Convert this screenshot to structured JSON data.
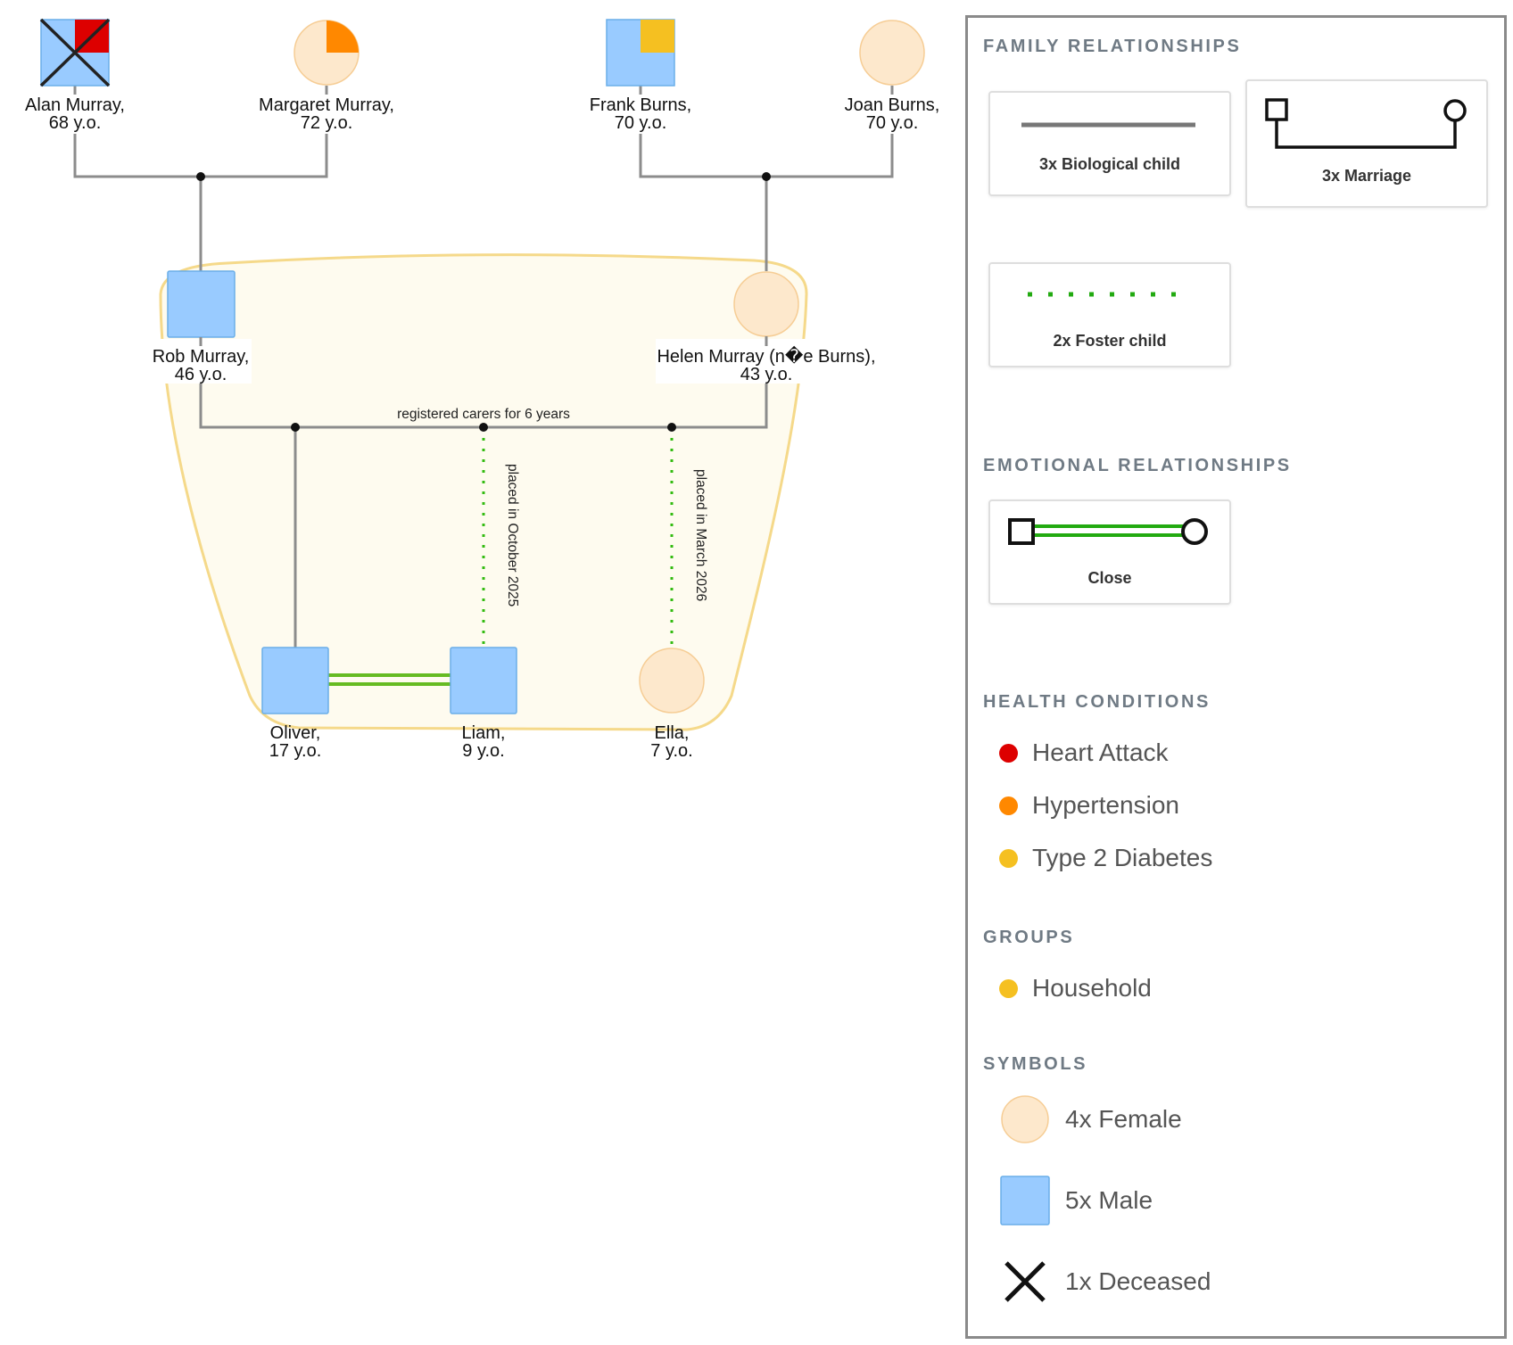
{
  "colors": {
    "male": "#99cbff",
    "male_stroke": "#6aaee8",
    "female": "#fde8cc",
    "female_stroke": "#f6cd95",
    "line_family": "#8c8c8c",
    "line_foster": "#33bb11",
    "line_close": "#66bb22",
    "household": "#f5c021",
    "household_fill": "#fefbef",
    "heart_attack": "#dd0000",
    "hypertension": "#ff8800",
    "type2_diabetes": "#f5c021",
    "deceased_mark": "#222222"
  },
  "people": [
    {
      "id": "alan",
      "name": "Alan Murray,",
      "age": "68 y.o.",
      "sex": "male",
      "deceased": true,
      "condition": "heart_attack"
    },
    {
      "id": "margaret",
      "name": "Margaret Murray,",
      "age": "72 y.o.",
      "sex": "female",
      "condition": "hypertension"
    },
    {
      "id": "frank",
      "name": "Frank Burns,",
      "age": "70 y.o.",
      "sex": "male",
      "condition": "type2_diabetes"
    },
    {
      "id": "joan",
      "name": "Joan Burns,",
      "age": "70 y.o.",
      "sex": "female"
    },
    {
      "id": "rob",
      "name": "Rob Murray,",
      "age": "46 y.o.",
      "sex": "male"
    },
    {
      "id": "helen",
      "name": "Helen Murray (n�e Burns),",
      "age": "43 y.o.",
      "sex": "female"
    },
    {
      "id": "oliver",
      "name": "Oliver,",
      "age": "17 y.o.",
      "sex": "male"
    },
    {
      "id": "liam",
      "name": "Liam,",
      "age": "9 y.o.",
      "sex": "male"
    },
    {
      "id": "ella",
      "name": "Ella,",
      "age": "7 y.o.",
      "sex": "female"
    }
  ],
  "relationship_labels": {
    "carers": "registered carers for 6 years",
    "liam_placement": "placed in October 2025",
    "ella_placement": "placed in March 2026"
  },
  "legend": {
    "family_heading": "FAMILY RELATIONSHIPS",
    "biological_child": "3x Biological child",
    "marriage": "3x Marriage",
    "foster_child": "2x Foster child",
    "emotional_heading": "EMOTIONAL RELATIONSHIPS",
    "close": "Close",
    "health_heading": "HEALTH CONDITIONS",
    "conditions": [
      {
        "label": "Heart Attack",
        "color_key": "heart_attack"
      },
      {
        "label": "Hypertension",
        "color_key": "hypertension"
      },
      {
        "label": "Type 2 Diabetes",
        "color_key": "type2_diabetes"
      }
    ],
    "groups_heading": "GROUPS",
    "groups": [
      {
        "label": "Household",
        "color_key": "household"
      }
    ],
    "symbols_heading": "SYMBOLS",
    "symbols": {
      "female": "4x Female",
      "male": "5x Male",
      "deceased": "1x Deceased"
    }
  }
}
